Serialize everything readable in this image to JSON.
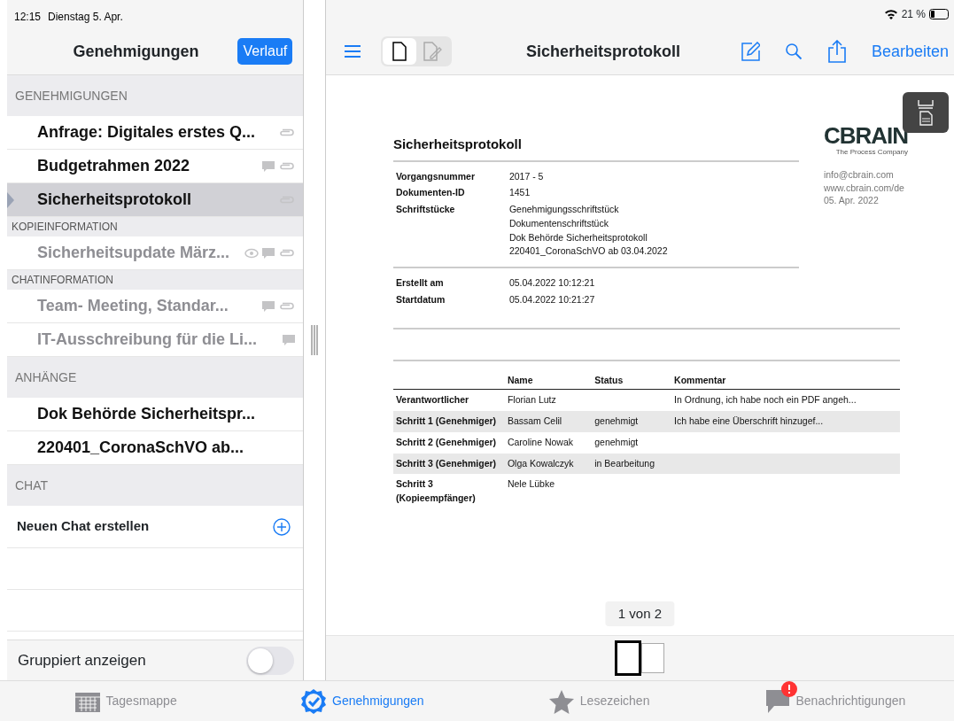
{
  "status_bar": {
    "time": "12:15",
    "date": "Dienstag 5. Apr.",
    "battery": "21 %"
  },
  "sidebar": {
    "title": "Genehmigungen",
    "history_button": "Verlauf",
    "sections": [
      {
        "title": "GENEHMIGUNGEN",
        "kind": "header",
        "items": [
          {
            "kind": "document",
            "label": "Anfrage: Digitales erstes Q...",
            "selected": false,
            "dimmed": false,
            "viewed": false,
            "comment": false,
            "attachment": true
          },
          {
            "kind": "document",
            "label": "Budgetrahmen 2022",
            "selected": false,
            "dimmed": false,
            "viewed": false,
            "comment": true,
            "attachment": true
          },
          {
            "kind": "document",
            "label": "Sicherheitsprotokoll",
            "selected": true,
            "dimmed": false,
            "viewed": false,
            "comment": false,
            "attachment": true
          }
        ]
      },
      {
        "title": "KOPIEINFORMATION",
        "kind": "subheader",
        "items": [
          {
            "kind": "document",
            "label": "Sicherheitsupdate März...",
            "selected": false,
            "dimmed": true,
            "viewed": true,
            "comment": true,
            "attachment": true
          }
        ]
      },
      {
        "title": "CHATINFORMATION",
        "kind": "subheader",
        "items": [
          {
            "kind": "document",
            "label": "Team- Meeting, Standar...",
            "selected": false,
            "dimmed": true,
            "viewed": false,
            "comment": true,
            "attachment": true
          },
          {
            "kind": "document",
            "label": "IT-Ausschreibung für die Li...",
            "selected": false,
            "dimmed": true,
            "viewed": false,
            "comment": true,
            "attachment": false
          }
        ]
      },
      {
        "title": "ANHÄNGE",
        "kind": "header",
        "items": [
          {
            "kind": "document",
            "label": "Dok Behörde Sicherheitspr...",
            "selected": false,
            "dimmed": false,
            "viewed": false,
            "comment": false,
            "attachment": false
          },
          {
            "kind": "document",
            "label": "220401_CoronaSchVO ab...",
            "selected": false,
            "dimmed": false,
            "viewed": false,
            "comment": false,
            "attachment": false
          }
        ]
      },
      {
        "title": "CHAT",
        "kind": "header",
        "items": [
          {
            "kind": "action",
            "label": "Neuen Chat erstellen"
          }
        ]
      }
    ],
    "toggle": {
      "label": "Gruppiert anzeigen",
      "on": false
    }
  },
  "toolbar": {
    "title": "Sicherheitsprotokoll",
    "view_modes": [
      {
        "kind": "page",
        "selected": true
      },
      {
        "kind": "annotate",
        "selected": false
      }
    ],
    "edit_button": "Bearbeiten"
  },
  "document": {
    "title": "Sicherheitsprotokoll",
    "logo": "CBRAIN",
    "logo_tagline": "The Process Company",
    "contact": [
      "info@cbrain.com",
      "www.cbrain.com/de",
      "05. Apr. 2022"
    ],
    "meta": [
      {
        "label": "Vorgangsnummer",
        "values": [
          "2017 - 5"
        ]
      },
      {
        "label": "Dokumenten-ID",
        "values": [
          "1451"
        ]
      },
      {
        "label": "Schriftstücke",
        "values": [
          "Genehmigungsschriftstück",
          "Dokumentenschriftstück",
          "Dok Behörde Sicherheitsprotokoll",
          "220401_CoronaSchVO ab 03.04.2022"
        ]
      }
    ],
    "dates": [
      {
        "label": "Erstellt am",
        "value": "05.04.2022 10:12:21"
      },
      {
        "label": "Startdatum",
        "value": "05.04.2022 10:21:27"
      }
    ],
    "table": {
      "columns": [
        "Name",
        "Status",
        "Kommentar"
      ],
      "rows": [
        {
          "step": "Verantwortlicher",
          "name": "Florian Lutz",
          "status": "",
          "comment": "In Ordnung, ich habe noch ein PDF angeh..."
        },
        {
          "step": "Schritt 1 (Genehmiger)",
          "name": "Bassam Celil",
          "status": "genehmigt",
          "comment": "Ich habe eine Überschrift hinzugef..."
        },
        {
          "step": "Schritt 2 (Genehmiger)",
          "name": "Caroline Nowak",
          "status": "genehmigt",
          "comment": ""
        },
        {
          "step": "Schritt 3 (Genehmiger)",
          "name": "Olga Kowalczyk",
          "status": "in Bearbeitung",
          "comment": ""
        },
        {
          "step": "Schritt 3 (Kopieempfänger)",
          "name": "Nele Lübke",
          "status": "",
          "comment": ""
        }
      ]
    }
  },
  "page_indicator": "1 von 2",
  "thumbnails": [
    {
      "selected": true
    },
    {
      "selected": false
    }
  ],
  "tab_bar": [
    {
      "kind": "calendar",
      "label": "Tagesmappe",
      "selected": false,
      "badge": false
    },
    {
      "kind": "approval",
      "label": "Genehmigungen",
      "selected": true,
      "badge": false
    },
    {
      "kind": "star",
      "label": "Lesezeichen",
      "selected": false,
      "badge": false
    },
    {
      "kind": "notification",
      "label": "Benachrichtigungen",
      "selected": false,
      "badge": true
    }
  ]
}
